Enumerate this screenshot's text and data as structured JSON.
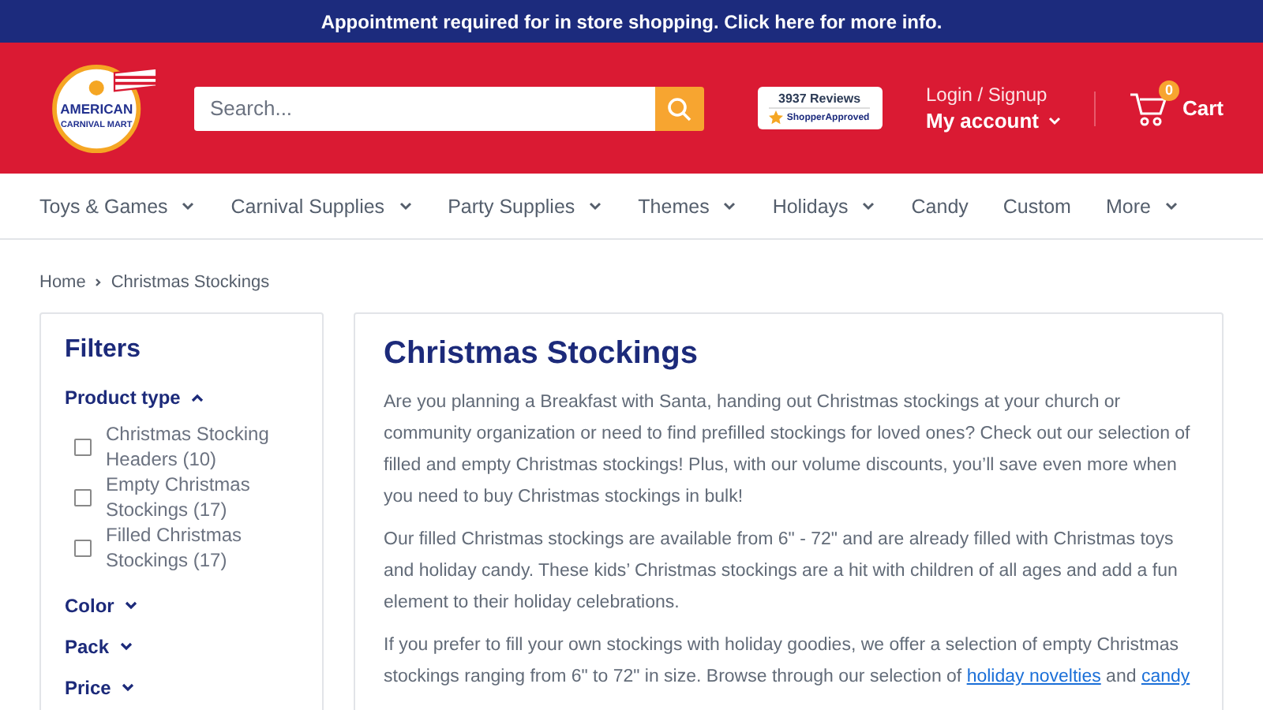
{
  "announcement": "Appointment required for in store shopping. Click here for more info.",
  "logo": {
    "line_1": "AMERICAN",
    "line_2": "CARNIVAL MART"
  },
  "search": {
    "placeholder": "Search..."
  },
  "reviews_badge": {
    "count": "3937 Reviews",
    "brand": "ShopperApproved"
  },
  "account": {
    "login": "Login / Signup",
    "label": "My account"
  },
  "cart": {
    "count": "0",
    "label": "Cart"
  },
  "nav": [
    {
      "label": "Toys & Games",
      "dropdown": true
    },
    {
      "label": "Carnival Supplies",
      "dropdown": true
    },
    {
      "label": "Party Supplies",
      "dropdown": true
    },
    {
      "label": "Themes",
      "dropdown": true
    },
    {
      "label": "Holidays",
      "dropdown": true
    },
    {
      "label": "Candy",
      "dropdown": false
    },
    {
      "label": "Custom",
      "dropdown": false
    },
    {
      "label": "More",
      "dropdown": true
    }
  ],
  "breadcrumb": [
    "Home",
    "Christmas Stockings"
  ],
  "filters": {
    "title": "Filters",
    "groups": [
      {
        "label": "Product type",
        "expanded": true,
        "options": [
          {
            "label": "Christmas Stocking Headers (10)",
            "checked": false
          },
          {
            "label": "Empty Christmas Stockings (17)",
            "checked": false
          },
          {
            "label": "Filled Christmas Stockings (17)",
            "checked": false
          }
        ]
      },
      {
        "label": "Color",
        "expanded": false
      },
      {
        "label": "Pack",
        "expanded": false
      },
      {
        "label": "Price",
        "expanded": false
      }
    ]
  },
  "content": {
    "title": "Christmas Stockings",
    "paragraphs": [
      [
        {
          "kind": "text",
          "text": "Are you planning a Breakfast with Santa, handing out Christmas stockings at your church or community organization or need to find prefilled stockings for loved ones? Check out our selection of filled and empty Christmas stockings! Plus, with our volume discounts, you’ll save even more when you need to buy Christmas stockings in bulk!"
        }
      ],
      [
        {
          "kind": "text",
          "text": "Our filled Christmas stockings are available from 6\" - 72\" and are already filled with Christmas toys and holiday candy. These kids’ Christmas stockings are a hit with children of all ages and add a fun element to their holiday celebrations."
        }
      ],
      [
        {
          "kind": "text",
          "text": "If you prefer to fill your own stockings with holiday goodies, we offer a selection of empty Christmas stockings ranging from 6\" to 72\" in size. Browse through our selection of "
        },
        {
          "kind": "link",
          "text": "holiday novelties"
        },
        {
          "kind": "text",
          "text": " and "
        },
        {
          "kind": "link",
          "text": "candy"
        }
      ]
    ]
  }
}
